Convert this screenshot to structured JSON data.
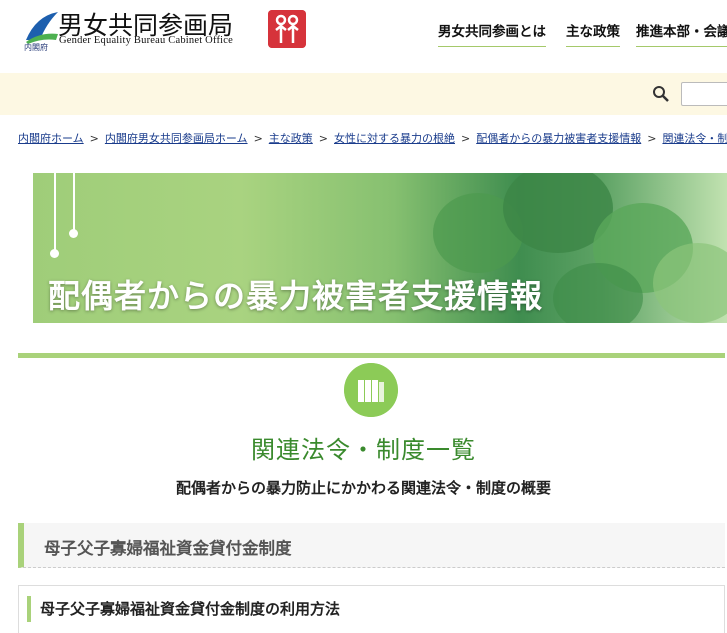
{
  "header": {
    "logo_sub": "内閣府",
    "title": "男女共同参画局",
    "subtitle": "Gender Equality Bureau Cabinet Office",
    "nav": [
      "男女共同参画とは",
      "主な政策",
      "推進本部・会議"
    ]
  },
  "search": {
    "placeholder": ""
  },
  "breadcrumb": [
    "内閣府ホーム",
    "内閣府男女共同参画局ホーム",
    "主な政策",
    "女性に対する暴力の根絶",
    "配偶者からの暴力被害者支援情報",
    "関連法令・制度一覧"
  ],
  "breadcrumb_sep": ">",
  "hero": {
    "title": "配偶者からの暴力被害者支援情報"
  },
  "section": {
    "title": "関連法令・制度一覧",
    "subtitle": "配偶者からの暴力防止にかかわる関連法令・制度の概要",
    "heading": "母子父子寡婦福祉資金貸付金制度",
    "subheading": "母子父子寡婦福祉資金貸付金制度の利用方法"
  },
  "colors": {
    "accent": "#a9d27a",
    "title_green": "#3a8a2d",
    "link": "#1a3c8c",
    "search_bg": "#fdf8e3",
    "badge": "#d6333b"
  }
}
